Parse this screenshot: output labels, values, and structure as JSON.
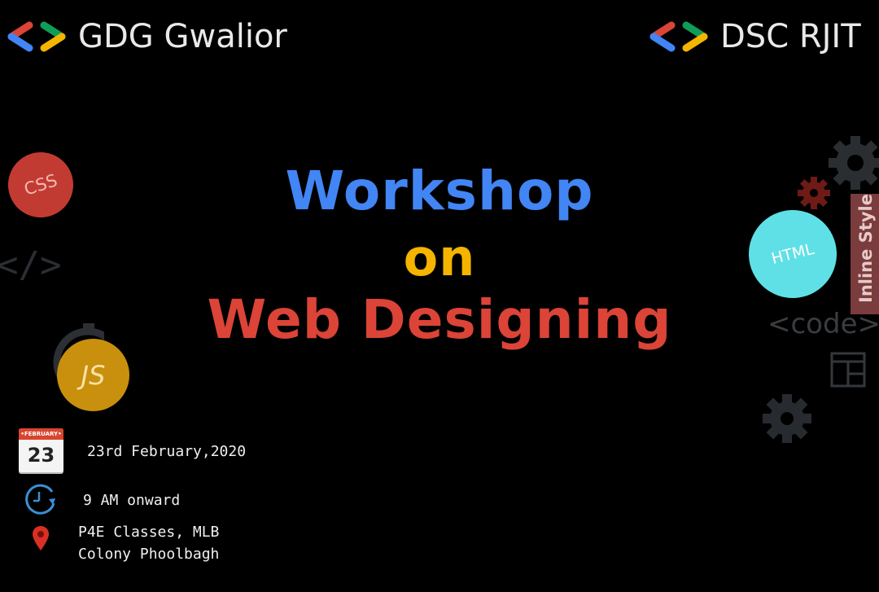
{
  "brands": {
    "left": "GDG Gwalior",
    "right": "DSC RJIT"
  },
  "title": {
    "line1": "Workshop",
    "line2": "on",
    "line3": "Web Designing"
  },
  "badges": {
    "css": "CSS",
    "js": "JS",
    "html": "HTML",
    "code_left": "</>",
    "code_right": "<code>",
    "inline_style": "Inline Style"
  },
  "calendar": {
    "month": "•FEBRUARY•",
    "day": "23"
  },
  "event": {
    "date": "23rd February,2020",
    "time": "9 AM onward",
    "venue_line1": "P4E Classes, MLB",
    "venue_line2": "Colony Phoolbagh"
  },
  "colors": {
    "google_blue": "#4285f4",
    "google_red": "#db4437",
    "google_yellow": "#f4b400",
    "google_green": "#0f9d58",
    "background": "#000000"
  },
  "icons": [
    "gdg-logo-icon",
    "calendar-icon",
    "clock-icon",
    "location-pin-icon",
    "gear-icon",
    "layout-icon",
    "stopwatch-icon"
  ]
}
